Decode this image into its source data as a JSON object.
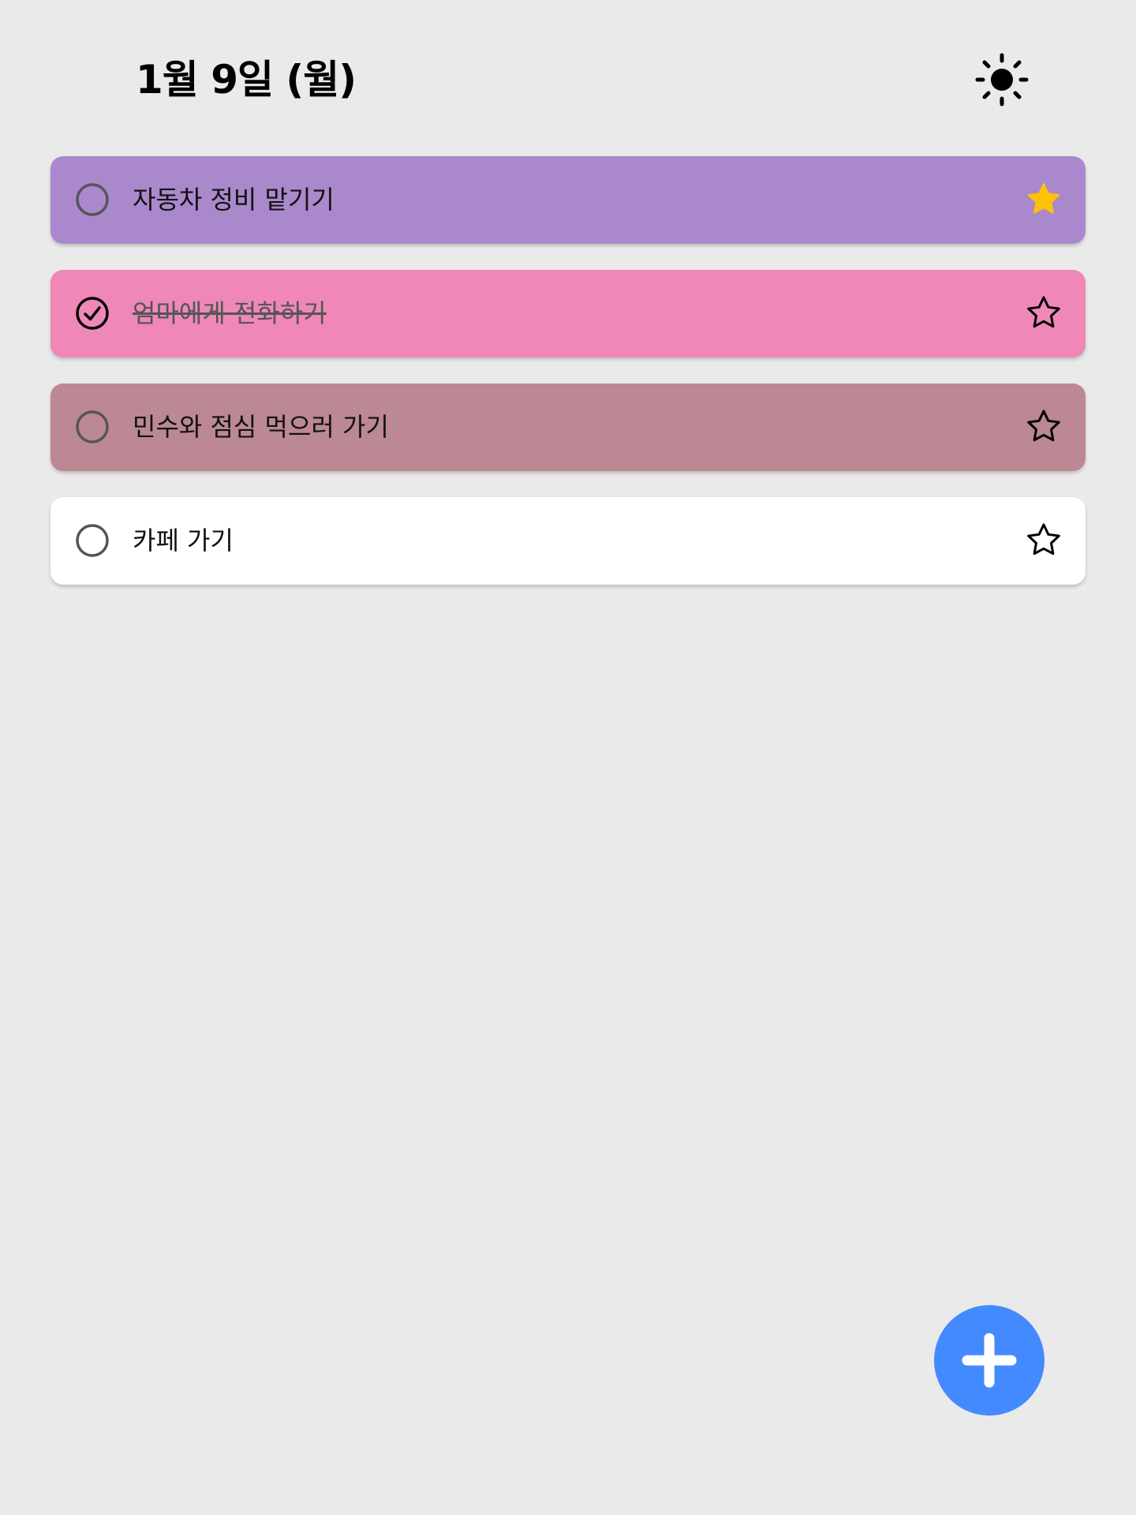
{
  "header": {
    "date": "1월 9일 (월)",
    "theme_icon": "sun-icon"
  },
  "todos": [
    {
      "text": "자동차 정비 맡기기",
      "done": false,
      "starred": true,
      "color": "#a988cc"
    },
    {
      "text": "엄마에게 전화하기",
      "done": true,
      "starred": false,
      "color": "#ef88b8"
    },
    {
      "text": "민수와 점심 먹으러 가기",
      "done": false,
      "starred": false,
      "color": "#bb8893"
    },
    {
      "text": "카페 가기",
      "done": false,
      "starred": false,
      "color": "#ffffff"
    }
  ],
  "colors": {
    "background": "#eaeaea",
    "star_active": "#ffc107",
    "fab": "#448aff"
  },
  "fab": {
    "icon": "plus-icon"
  }
}
